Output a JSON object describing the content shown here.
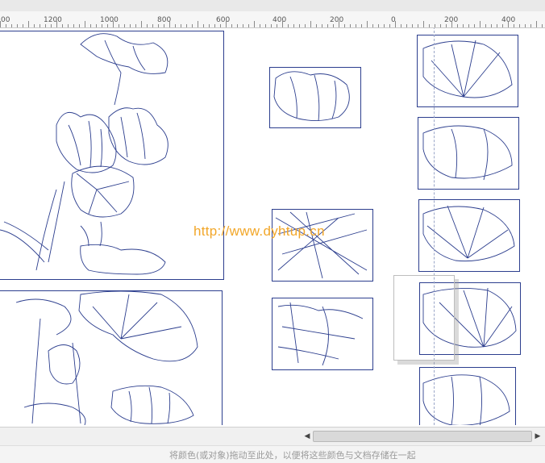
{
  "ruler": {
    "labels": [
      "00",
      "1200",
      "1000",
      "800",
      "600",
      "400",
      "200",
      "0",
      "200",
      "400"
    ]
  },
  "canvas": {
    "watermark": "http://www.dyhtup.cn",
    "stroke_color": "#2c3e8e",
    "watermark_color": "#f2a72a"
  },
  "status": {
    "hint": "将颜色(或对象)拖动至此处，以便将这些颜色与文档存储在一起"
  },
  "icons": {
    "scroll_left": "chevron-left-icon",
    "scroll_right": "chevron-right-icon"
  }
}
